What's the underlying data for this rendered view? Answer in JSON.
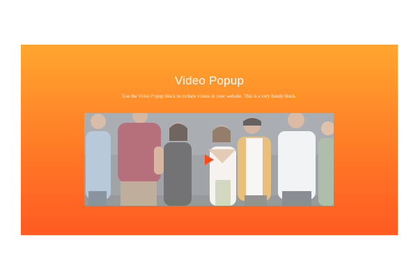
{
  "section": {
    "title": "Video Popup",
    "subtitle": "Use the Video Popup block to include videos in your website. This is a very handy block."
  },
  "video": {
    "thumbnail_alt": "Group of smiling people standing together",
    "play_icon": "play-icon"
  },
  "colors": {
    "gradient_top": "#ffa62f",
    "gradient_bottom": "#ff5a22",
    "play_accent": "#ff4a1a",
    "text": "#ffffff"
  }
}
